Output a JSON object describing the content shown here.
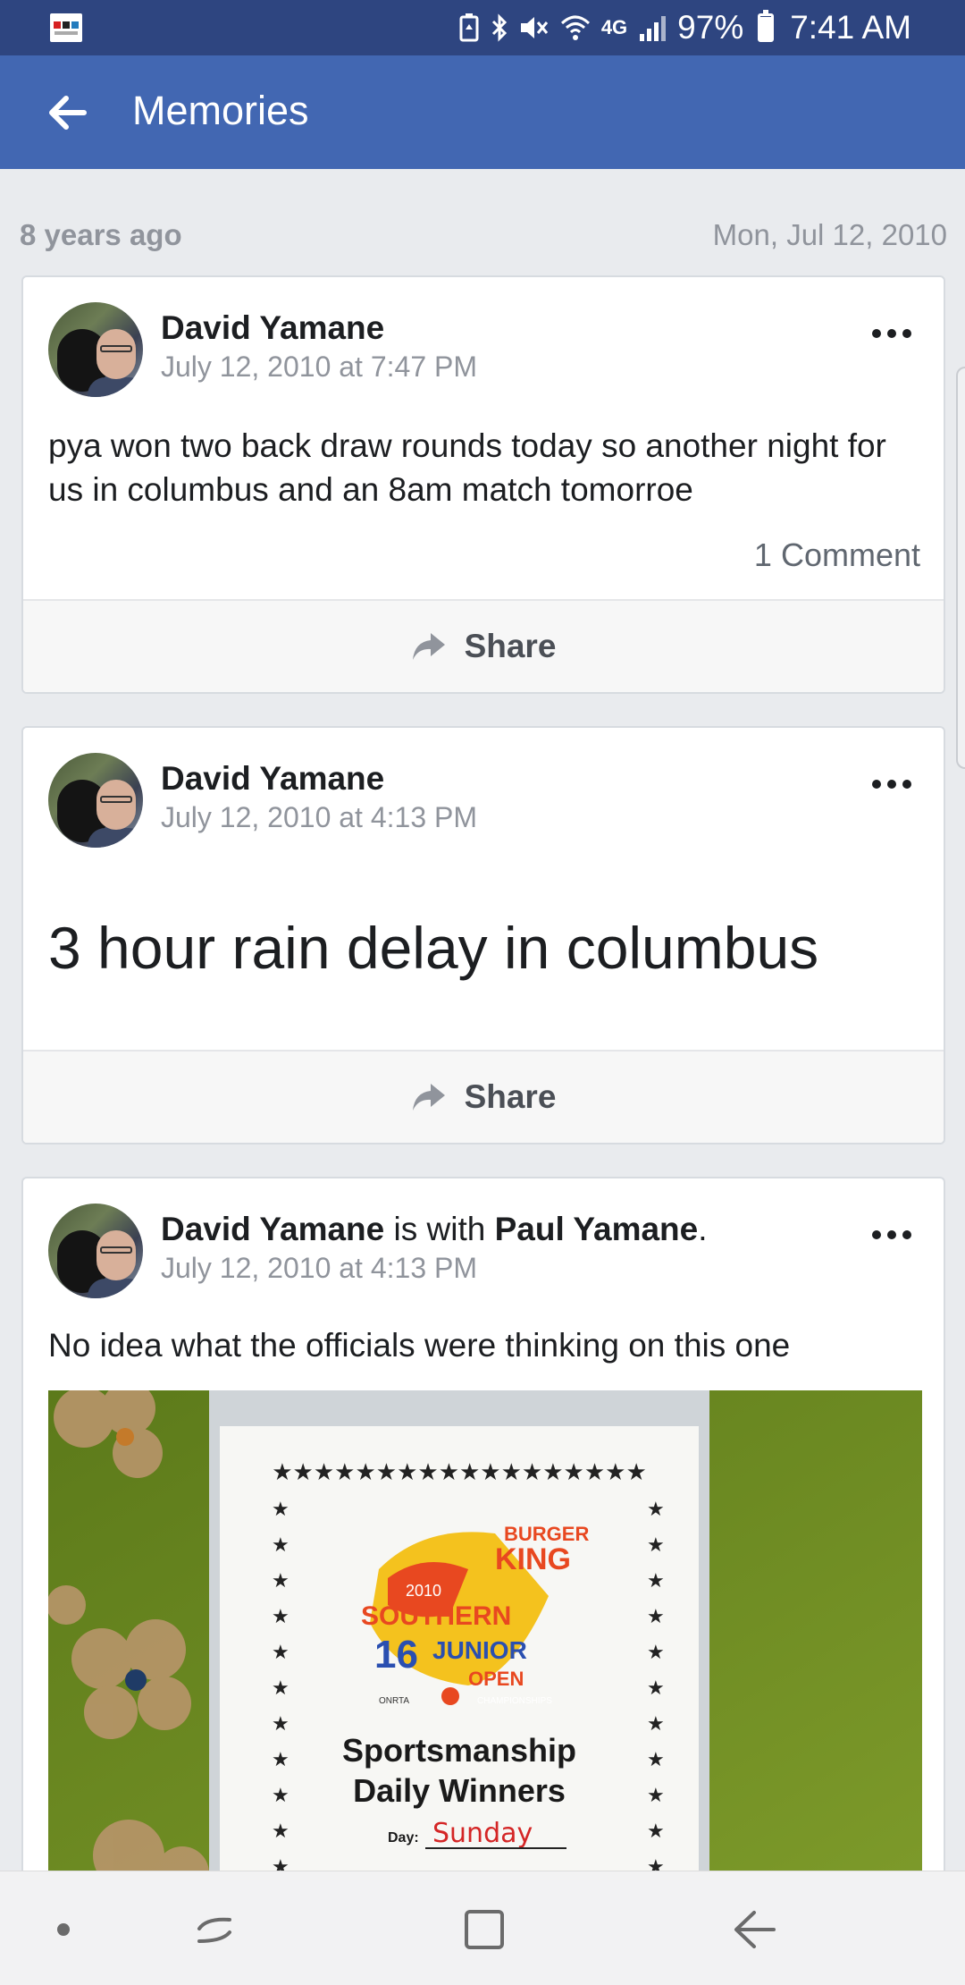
{
  "status_bar": {
    "notification_icon": "npr-news-icon",
    "icons": [
      "battery-saver-icon",
      "bluetooth-icon",
      "mute-vibrate-icon",
      "wifi-icon",
      "4g-lte-icon",
      "signal-icon"
    ],
    "network": "4G",
    "battery_percent": "97%",
    "time": "7:41 AM"
  },
  "app_bar": {
    "title": "Memories",
    "back_icon": "arrow-left-icon"
  },
  "memories": {
    "years_ago": "8 years ago",
    "date": "Mon, Jul 12, 2010"
  },
  "posts": [
    {
      "author": "David Yamane",
      "time": "July 12, 2010 at 7:47 PM",
      "text": "pya won two back draw rounds today so another night for us in columbus and an 8am match tomorroe",
      "comments": "1 Comment",
      "share_label": "Share"
    },
    {
      "author": "David Yamane",
      "time": "July 12, 2010 at 4:13 PM",
      "text": "3 hour rain delay in columbus",
      "share_label": "Share"
    },
    {
      "author": "David Yamane",
      "with_text": " is with ",
      "tagged": "Paul Yamane",
      "period": ".",
      "time": "July 12, 2010 at 4:13 PM",
      "text": "No idea what the officials were thinking on this one",
      "image": {
        "logo_line1": "BURGER",
        "logo_line2": "KING",
        "year": "2010",
        "logo_southern": "SOUTHERN",
        "logo_16": "16",
        "logo_junior": "JUNIOR",
        "logo_open": "OPEN",
        "logo_champs": "CHAMPIONSHIPS",
        "logo_sponsor": "ONRTA",
        "title1": "Sportsmanship",
        "title2": "Daily Winners",
        "day_label": "Day:",
        "day_value": "Sunday",
        "stars": "★★★★★★★★★★★★★★★★★★"
      }
    }
  ],
  "nav_bar": {
    "icons": [
      "nav-dot-icon",
      "recent-apps-icon",
      "home-icon",
      "back-icon"
    ]
  },
  "colors": {
    "status_bar": "#2e4580",
    "app_bar": "#4267b2",
    "background": "#e9ebee",
    "secondary_text": "#90949c"
  }
}
